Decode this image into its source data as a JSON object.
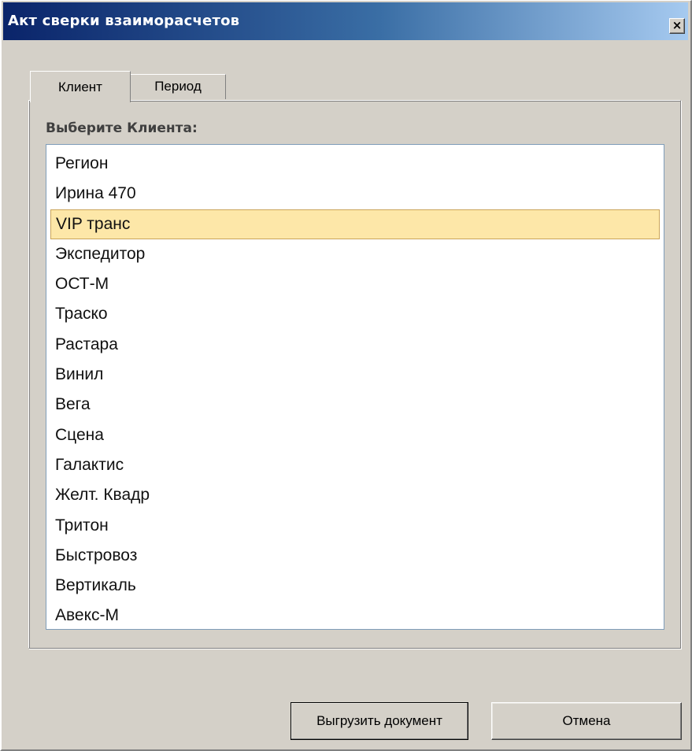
{
  "window": {
    "title": "Акт сверки взаиморасчетов",
    "close_icon": "close-icon",
    "close_glyph": "×"
  },
  "tabs": [
    {
      "label": "Клиент",
      "active": true
    },
    {
      "label": "Период",
      "active": false
    }
  ],
  "client_panel": {
    "group_label": "Выберите Клиента:",
    "selected_index": 2,
    "items": [
      "Регион",
      "Ирина 470",
      "VIP транс",
      "Экспедитор",
      "ОСТ-М",
      "Траско",
      "Растара",
      "Винил",
      "Вега",
      "Сцена",
      "Галактис",
      "Желт. Квадр",
      "Тритон",
      "Быстровоз",
      "Вертикаль",
      "Авекс-М"
    ]
  },
  "buttons": {
    "export_label": "Выгрузить документ",
    "cancel_label": "Отмена"
  },
  "colors": {
    "selection_fill": "#fde7a8",
    "titlebar_start": "#0a246a",
    "titlebar_end": "#a6caf0"
  }
}
